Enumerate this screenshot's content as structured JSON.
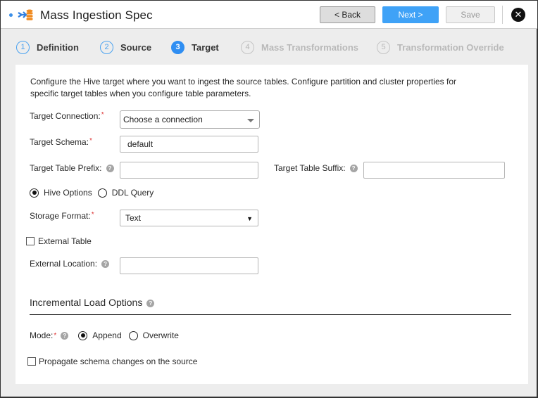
{
  "header": {
    "title": "Mass Ingestion Spec",
    "logo_icon": "mass-ingestion-icon",
    "back_label": "< Back",
    "next_label": "Next >",
    "save_label": "Save",
    "close_icon": "close-icon",
    "colors": {
      "accent": "#3fa2f7",
      "logo_arrow": "#2f7fe0",
      "logo_db": "#f08a1e"
    }
  },
  "steps": [
    {
      "num": "1",
      "label": "Definition",
      "state": "completed"
    },
    {
      "num": "2",
      "label": "Source",
      "state": "completed"
    },
    {
      "num": "3",
      "label": "Target",
      "state": "active"
    },
    {
      "num": "4",
      "label": "Mass Transformations",
      "state": "disabled"
    },
    {
      "num": "5",
      "label": "Transformation Override",
      "state": "disabled"
    }
  ],
  "form": {
    "description": "Configure the Hive target where you want to ingest the source tables. Configure partition and cluster properties for specific target tables when you configure table parameters.",
    "target_connection": {
      "label": "Target Connection:",
      "required": "*",
      "value": "Choose a connection"
    },
    "target_schema": {
      "label": "Target Schema:",
      "required": "*",
      "value": "default"
    },
    "target_table_prefix": {
      "label": "Target Table Prefix:",
      "value": ""
    },
    "target_table_suffix": {
      "label": "Target Table Suffix:",
      "value": ""
    },
    "options": [
      {
        "label": "Hive Options",
        "selected": true
      },
      {
        "label": "DDL Query",
        "selected": false
      }
    ],
    "storage_format": {
      "label": "Storage Format:",
      "required": "*",
      "value": "Text"
    },
    "external_table": {
      "label": "External Table",
      "checked": false
    },
    "external_location": {
      "label": "External Location:",
      "value": ""
    },
    "incremental": {
      "title": "Incremental Load Options",
      "mode_label": "Mode:",
      "required": "*",
      "modes": [
        {
          "label": "Append",
          "selected": true
        },
        {
          "label": "Overwrite",
          "selected": false
        }
      ],
      "propagate": {
        "label": "Propagate schema changes on the source",
        "checked": false
      }
    },
    "help_glyph": "?",
    "required_color": "#dd3333"
  }
}
